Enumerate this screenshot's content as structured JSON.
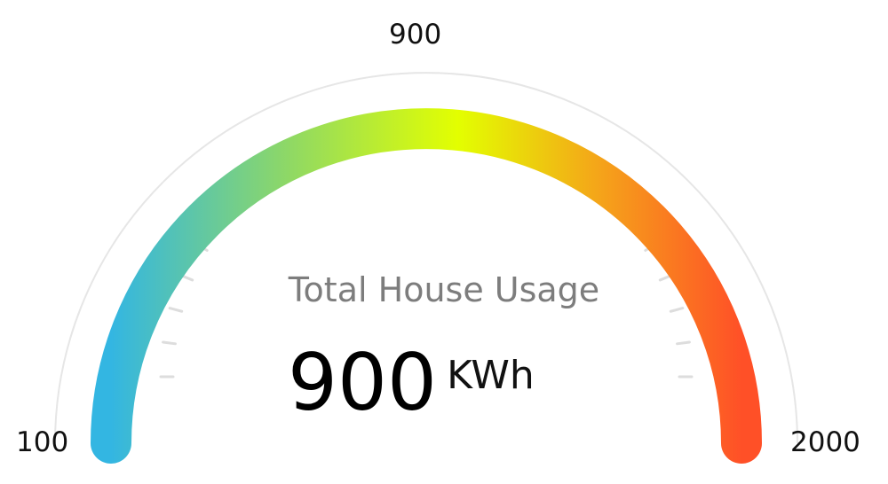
{
  "chart_data": {
    "type": "gauge",
    "title": "Total House Usage",
    "value": 900,
    "value_text": "900",
    "unit": "KWh",
    "min": 100,
    "max": 2000,
    "min_label": "100",
    "max_label": "2000",
    "value_label": "900",
    "gradient_colors": [
      "#33b6e2",
      "#8ed866",
      "#e3ff00",
      "#f5a21a",
      "#ff5027"
    ],
    "track_color": "#e6e6e6",
    "tick_color": "#dddddd"
  }
}
